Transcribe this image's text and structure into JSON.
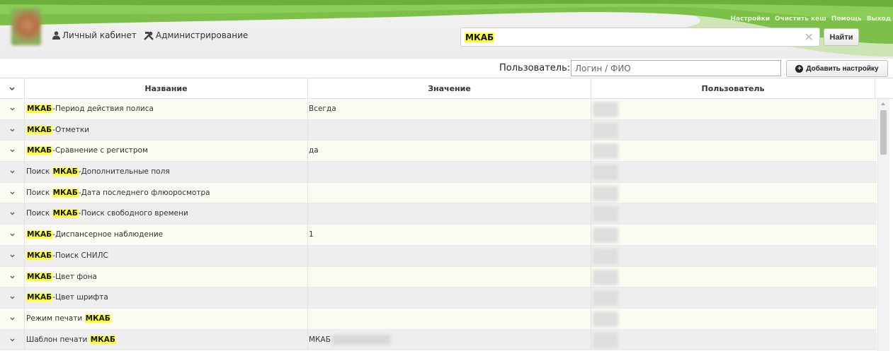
{
  "header": {
    "top_links": [
      "Настройки",
      "Очистить кеш",
      "Помощь",
      "Выход"
    ],
    "nav": {
      "cabinet_label": "Личный кабинет",
      "admin_label": "Администрирование"
    },
    "search": {
      "value": "МКАБ",
      "button_label": "Найти"
    }
  },
  "filter": {
    "user_label": "Пользователь:",
    "user_placeholder": "Логин / ФИО",
    "add_button_label": "Добавить настройку"
  },
  "table": {
    "columns": [
      "Название",
      "Значение",
      "Пользователь"
    ],
    "rows": [
      {
        "prefix": "",
        "highlight": "МКАБ",
        "suffix": "-Период действия полиса",
        "value": "Всегда"
      },
      {
        "prefix": "",
        "highlight": "МКАБ",
        "suffix": "-Отметки",
        "value": ""
      },
      {
        "prefix": "",
        "highlight": "МКАБ",
        "suffix": "-Сравнение с регистром",
        "value": "да"
      },
      {
        "prefix": "Поиск ",
        "highlight": "МКАБ",
        "suffix": "-Дополнительные поля",
        "value": ""
      },
      {
        "prefix": "Поиск ",
        "highlight": "МКАБ",
        "suffix": "-Дата последнего флюоросмотра",
        "value": ""
      },
      {
        "prefix": "Поиск ",
        "highlight": "МКАБ",
        "suffix": "-Поиск свободного времени",
        "value": ""
      },
      {
        "prefix": "",
        "highlight": "МКАБ",
        "suffix": "-Диспансерное наблюдение",
        "value": "1"
      },
      {
        "prefix": "",
        "highlight": "МКАБ",
        "suffix": "-Поиск СНИЛС",
        "value": ""
      },
      {
        "prefix": "",
        "highlight": "МКАБ",
        "suffix": "-Цвет фона",
        "value": ""
      },
      {
        "prefix": "",
        "highlight": "МКАБ",
        "suffix": "-Цвет шрифта",
        "value": ""
      },
      {
        "prefix": "Режим печати ",
        "highlight": "МКАБ",
        "suffix": "",
        "value": ""
      },
      {
        "prefix": "Шаблон печати ",
        "highlight": "МКАБ",
        "suffix": "",
        "value": "МКАБ"
      }
    ]
  },
  "colors": {
    "highlight": "#ffff33",
    "header_green": "#7cc04a",
    "row_odd": "#fbfbf3",
    "row_even": "#eeeeee"
  },
  "icons": {
    "cabinet": "user-icon",
    "admin": "tools-icon",
    "clear": "close-icon",
    "add": "plus-circle-icon",
    "expand": "chevron-down-icon"
  }
}
